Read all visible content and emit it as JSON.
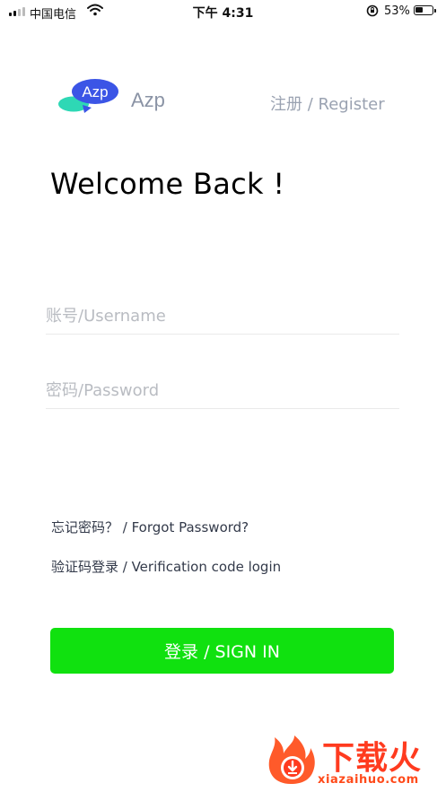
{
  "status_bar": {
    "carrier": "中国电信",
    "time": "下午 4:31",
    "battery": "53%",
    "battery_level": 0.53,
    "icons": [
      "signal-icon",
      "wifi-icon",
      "rotation-lock-icon",
      "battery-icon"
    ]
  },
  "header": {
    "logo_text": "Azp",
    "app_name": "Azp",
    "register_label": "注册 / Register"
  },
  "welcome": "Welcome Back !",
  "form": {
    "username_placeholder": "账号/Username",
    "password_placeholder": "密码/Password",
    "forgot_label": "忘记密码？ / Forgot Password?",
    "verification_label": "验证码登录 / Verification code login",
    "signin_label": "登录 / SIGN IN"
  },
  "watermark": {
    "text": "下载火",
    "url": "xiazaihuo.com"
  },
  "colors": {
    "accent": "#10e10f",
    "logo_blue": "#3b55e6",
    "logo_teal": "#2ed8b5",
    "muted": "#9aa2b1",
    "watermark": "#ff3b1f"
  }
}
